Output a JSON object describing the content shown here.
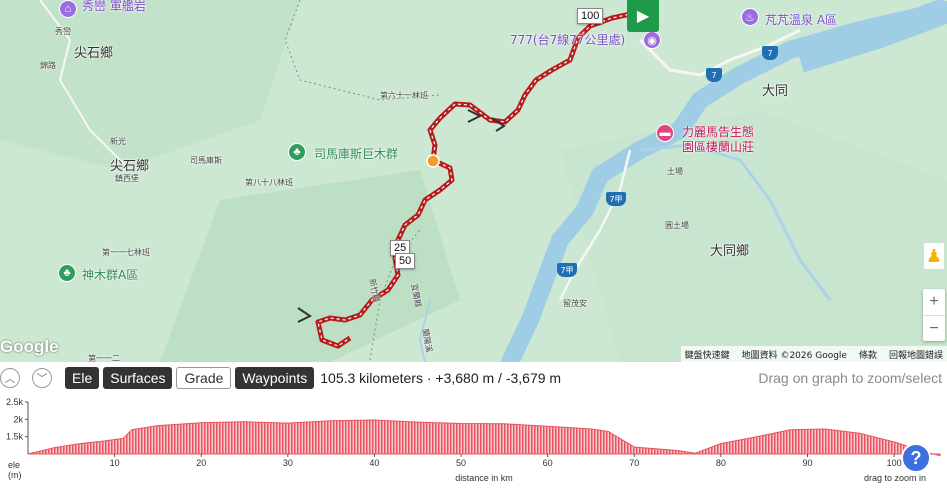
{
  "map": {
    "labels": [
      {
        "id": "xiumi",
        "text": "秀巒 軍艦岩",
        "cls": "lbl-purple"
      },
      {
        "id": "jianshi-village-n",
        "text": "尖石鄉",
        "cls": "lbl-lg"
      },
      {
        "id": "jianshi-village",
        "text": "尖石鄉",
        "cls": "lbl-lg"
      },
      {
        "id": "datong",
        "text": "大同",
        "cls": "lbl-lg"
      },
      {
        "id": "datong-village",
        "text": "大同鄉",
        "cls": "lbl-lg"
      },
      {
        "id": "smangus",
        "text": "司馬庫斯巨木群",
        "cls": "lbl-poi"
      },
      {
        "id": "shenmu",
        "text": "神木群A區",
        "cls": "lbl-poi"
      },
      {
        "id": "fanfan",
        "text": "芃芃溫泉 A區",
        "cls": "lbl-purple"
      },
      {
        "id": "limagao1",
        "text": "力麗馬告生態",
        "cls": "lbl-pink"
      },
      {
        "id": "limagao2",
        "text": "園區棲蘭山莊",
        "cls": "lbl-pink"
      },
      {
        "id": "road777",
        "text": "777(台7線77公里處)",
        "cls": "lbl-purple"
      },
      {
        "id": "xiuluan",
        "text": "秀巒",
        "cls": "lbl-sm"
      },
      {
        "id": "lulu",
        "text": "錦路",
        "cls": "lbl-sm"
      },
      {
        "id": "xinguang",
        "text": "新光",
        "cls": "lbl-sm"
      },
      {
        "id": "simakuxi",
        "text": "司馬庫斯",
        "cls": "lbl-sm"
      },
      {
        "id": "jinbaikou",
        "text": "鎮西堡",
        "cls": "lbl-sm"
      },
      {
        "id": "forest61",
        "text": "第六十一林班",
        "cls": "lbl-sm"
      },
      {
        "id": "forest88",
        "text": "第八十八林班",
        "cls": "lbl-sm"
      },
      {
        "id": "forest111",
        "text": "第一一七林班",
        "cls": "lbl-sm"
      },
      {
        "id": "forest-bottom",
        "text": "第一一二",
        "cls": "lbl-sm"
      },
      {
        "id": "tuchang",
        "text": "土場",
        "cls": "lbl-sm"
      },
      {
        "id": "nantuchang",
        "text": "圓土場",
        "cls": "lbl-sm"
      },
      {
        "id": "liumaoan",
        "text": "留茂安",
        "cls": "lbl-sm"
      },
      {
        "id": "hsinchu",
        "text": "新竹縣",
        "cls": "lbl-sm"
      },
      {
        "id": "yilan",
        "text": "宜蘭縣",
        "cls": "lbl-sm"
      },
      {
        "id": "lanyang",
        "text": "蘭陽溪",
        "cls": "lbl-sm"
      }
    ],
    "highways": [
      "7",
      "7",
      "7甲",
      "7甲"
    ],
    "km_flags": [
      "100",
      "25",
      "50"
    ],
    "google": "Google",
    "attribution": [
      "鍵盤快速鍵",
      "地圖資料 ©2026 Google",
      "條款",
      "回報地圖錯誤"
    ],
    "zoom_in": "+",
    "zoom_out": "−"
  },
  "controls": {
    "collapse_up": "︿",
    "collapse_down": "﹀",
    "tabs": [
      {
        "label": "Ele",
        "active": true
      },
      {
        "label": "Surfaces",
        "active": true
      },
      {
        "label": "Grade",
        "active": false
      },
      {
        "label": "Waypoints",
        "active": true
      }
    ],
    "stats": "105.3 kilometers · +3,680 m / -3,679 m",
    "hint": "Drag on graph to zoom/select"
  },
  "elevation": {
    "y_ticks": [
      "2.5k",
      "2k",
      "1.5k"
    ],
    "x_ticks": [
      "10",
      "20",
      "30",
      "40",
      "50",
      "60",
      "70",
      "80",
      "90",
      "100"
    ],
    "ylabel": "ele\n(m)",
    "xlabel": "distance in km",
    "drag_hint": "drag to zoom in",
    "profile_km": [
      0,
      3,
      6,
      9,
      11,
      12,
      15,
      20,
      25,
      30,
      35,
      40,
      45,
      50,
      55,
      60,
      65,
      67,
      70,
      75,
      77,
      80,
      85,
      88,
      92,
      96,
      100,
      103,
      105.3
    ],
    "profile_m": [
      1000,
      1180,
      1300,
      1380,
      1450,
      1700,
      1820,
      1900,
      1930,
      1890,
      1960,
      1980,
      1920,
      1880,
      1870,
      1800,
      1720,
      1650,
      1200,
      1100,
      1020,
      1300,
      1540,
      1700,
      1720,
      1600,
      1350,
      1100,
      950
    ],
    "color": "#e8535f"
  },
  "help": "?"
}
